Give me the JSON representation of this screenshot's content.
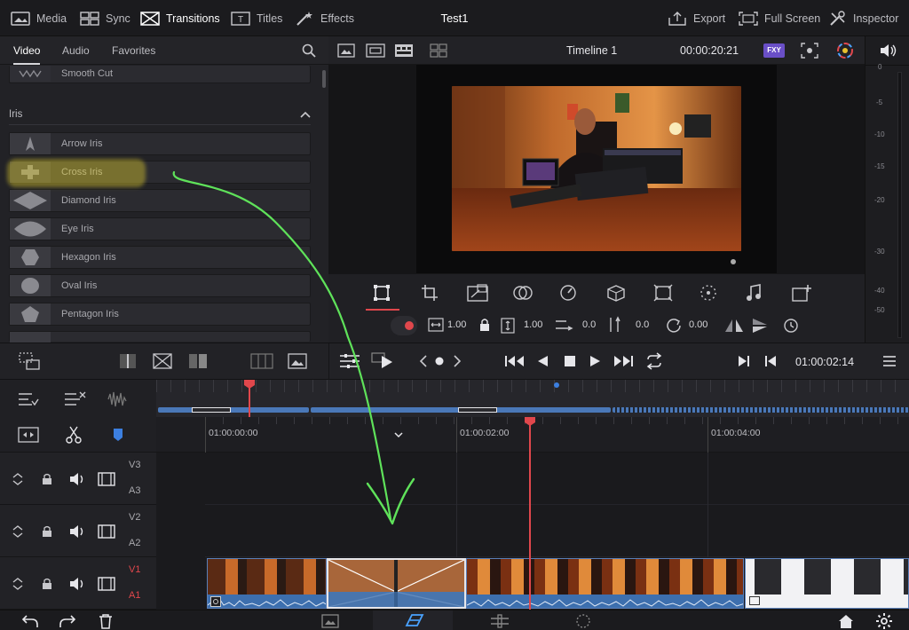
{
  "topbar": {
    "media": "Media",
    "sync": "Sync",
    "transitions": "Transitions",
    "titles": "Titles",
    "effects": "Effects",
    "project_title": "Test1",
    "export": "Export",
    "full_screen": "Full Screen",
    "inspector": "Inspector"
  },
  "browser": {
    "tabs": [
      "Video",
      "Audio",
      "Favorites"
    ],
    "active_tab": "Video",
    "prev_item": "Smooth Cut",
    "section": "Iris",
    "items": [
      "Arrow Iris",
      "Cross Iris",
      "Diamond Iris",
      "Eye Iris",
      "Hexagon Iris",
      "Oval Iris",
      "Pentagon Iris"
    ],
    "highlighted": "Cross Iris"
  },
  "viewer": {
    "timeline_name": "Timeline 1",
    "timecode": "00:00:20:21",
    "badge": "FXY",
    "params": {
      "width": "1.00",
      "height": "1.00",
      "position": "0.0",
      "offset": "0.0",
      "rotation": "0.00"
    }
  },
  "volume": {
    "ticks": [
      "0",
      "-5",
      "-10",
      "-15",
      "-20",
      "-30",
      "-40",
      "-50"
    ]
  },
  "transport": {
    "timecode": "01:00:02:14"
  },
  "tracks": {
    "video": [
      "V3",
      "V2",
      "V1"
    ],
    "audio": [
      "A3",
      "A2",
      "A1"
    ]
  },
  "ruler": {
    "ticks": [
      "01:00:00:00",
      "01:00:02:00",
      "01:00:04:00"
    ]
  },
  "colors": {
    "accent_red": "#e0474c",
    "clip_blue": "#3d6fae",
    "annotation_green": "#5fe25a",
    "highlight_yellow": "#d8c62e"
  }
}
